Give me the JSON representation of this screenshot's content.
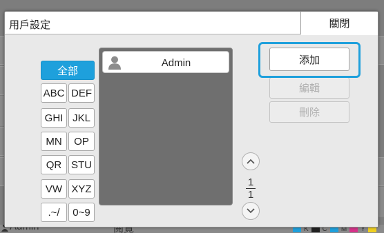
{
  "dialog": {
    "title": "用戶設定",
    "close_label": "關閉"
  },
  "index_buttons": {
    "all": "全部",
    "abc": "ABC",
    "def": "DEF",
    "ghi": "GHI",
    "jkl": "JKL",
    "mn": "MN",
    "op": "OP",
    "qr": "QR",
    "stu": "STU",
    "vw": "VW",
    "xyz": "XYZ",
    "symbols": ".~/",
    "digits": "0~9"
  },
  "user_list": {
    "items": [
      {
        "name": "Admin"
      }
    ]
  },
  "paging": {
    "current": "1",
    "total": "1"
  },
  "actions": {
    "add": "添加",
    "edit": "編輯",
    "delete": "刪除"
  },
  "background": {
    "user": "Admin",
    "center": "閱覽",
    "ink": [
      "K",
      "C",
      "M",
      "Y"
    ]
  },
  "colors": {
    "accent": "#1ea0dc",
    "ink_k": "#222222",
    "ink_c": "#1ea0dc",
    "ink_m": "#d6338a",
    "ink_y": "#f0d020"
  }
}
